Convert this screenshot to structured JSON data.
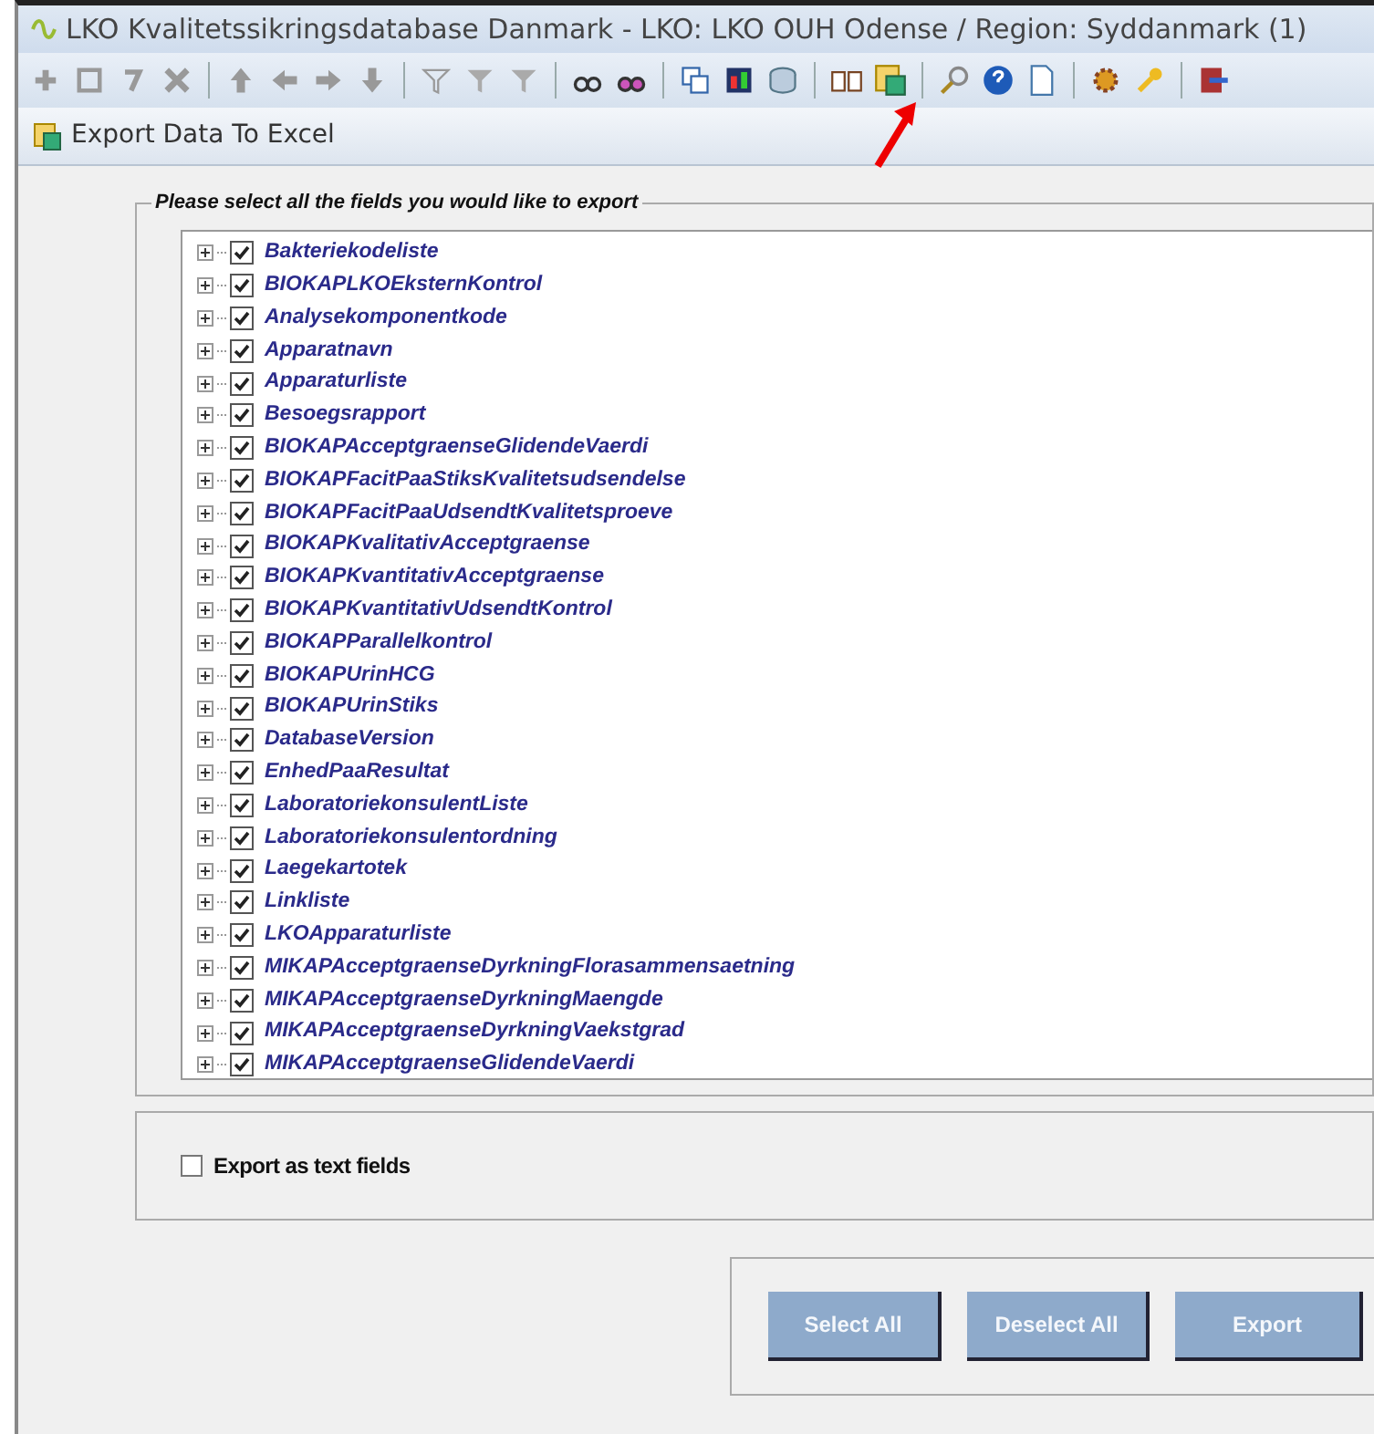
{
  "window": {
    "title": "LKO Kvalitetssikringsdatabase Danmark - LKO: LKO OUH Odense / Region: Syddanmark (1)"
  },
  "dialog": {
    "title": "Export Data To Excel"
  },
  "fields_group": {
    "legend": "Please select all the fields you would like to export",
    "items": [
      {
        "label": "Bakteriekodeliste",
        "checked": true,
        "expanded": false
      },
      {
        "label": "BIOKAPLKOEksternKontrol",
        "checked": true,
        "expanded": false
      },
      {
        "label": "Analysekomponentkode",
        "checked": true,
        "expanded": false
      },
      {
        "label": "Apparatnavn",
        "checked": true,
        "expanded": false
      },
      {
        "label": "Apparaturliste",
        "checked": true,
        "expanded": false
      },
      {
        "label": "Besoegsrapport",
        "checked": true,
        "expanded": false
      },
      {
        "label": "BIOKAPAcceptgraenseGlidendeVaerdi",
        "checked": true,
        "expanded": false
      },
      {
        "label": "BIOKAPFacitPaaStiksKvalitetsudsendelse",
        "checked": true,
        "expanded": false
      },
      {
        "label": "BIOKAPFacitPaaUdsendtKvalitetsproeve",
        "checked": true,
        "expanded": false
      },
      {
        "label": "BIOKAPKvalitativAcceptgraense",
        "checked": true,
        "expanded": false
      },
      {
        "label": "BIOKAPKvantitativAcceptgraense",
        "checked": true,
        "expanded": false
      },
      {
        "label": "BIOKAPKvantitativUdsendtKontrol",
        "checked": true,
        "expanded": false
      },
      {
        "label": "BIOKAPParallelkontrol",
        "checked": true,
        "expanded": false
      },
      {
        "label": "BIOKAPUrinHCG",
        "checked": true,
        "expanded": false
      },
      {
        "label": "BIOKAPUrinStiks",
        "checked": true,
        "expanded": false
      },
      {
        "label": "DatabaseVersion",
        "checked": true,
        "expanded": false
      },
      {
        "label": "EnhedPaaResultat",
        "checked": true,
        "expanded": false
      },
      {
        "label": "LaboratoriekonsulentListe",
        "checked": true,
        "expanded": false
      },
      {
        "label": "Laboratoriekonsulentordning",
        "checked": true,
        "expanded": false
      },
      {
        "label": "Laegekartotek",
        "checked": true,
        "expanded": false
      },
      {
        "label": "Linkliste",
        "checked": true,
        "expanded": false
      },
      {
        "label": "LKOApparaturliste",
        "checked": true,
        "expanded": false
      },
      {
        "label": "MIKAPAcceptgraenseDyrkningFlorasammensaetning",
        "checked": true,
        "expanded": false
      },
      {
        "label": "MIKAPAcceptgraenseDyrkningMaengde",
        "checked": true,
        "expanded": false
      },
      {
        "label": "MIKAPAcceptgraenseDyrkningVaekstgrad",
        "checked": true,
        "expanded": false
      },
      {
        "label": "MIKAPAcceptgraenseGlidendeVaerdi",
        "checked": true,
        "expanded": false
      }
    ]
  },
  "export_option": {
    "label": "Export as text fields",
    "checked": false
  },
  "buttons": [
    "Select All",
    "Deselect All",
    "Export"
  ]
}
